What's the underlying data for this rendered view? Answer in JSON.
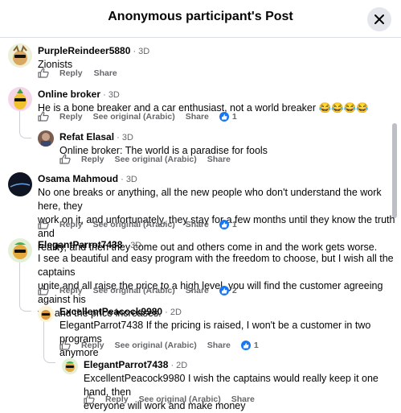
{
  "dialog": {
    "title": "Anonymous participant's Post"
  },
  "labels": {
    "reply": "Reply",
    "share": "Share",
    "see_original": "See original (Arabic)"
  },
  "comments": [
    {
      "author": "PurpleReindeer5880",
      "time": "3D",
      "text": "Zionists"
    },
    {
      "author": "Online broker",
      "time": "3D",
      "text": "He is a bone breaker and a car enthusiast, not a world breaker 😂😂😂😂",
      "reactions": "1"
    },
    {
      "author": "Refat Elasal",
      "time": "3D",
      "text": "Online broker: The world is a paradise for fools"
    },
    {
      "author": "Osama Mahmoud",
      "time": "3D",
      "text_lines": [
        "No one breaks or anything, all the new people who don't understand the work here, they",
        "work on it, and unfortunately, they stay for a few months until they know the truth and",
        "reality, and then they come out and others come in and the work gets worse."
      ],
      "reactions": "1"
    },
    {
      "author": "ElegantParrot7438",
      "time": "3D",
      "text_lines": [
        "I see a beautiful and easy program with the freedom to choose, but I wish all the captains",
        "unite and all raise the price to a high level, you will find the customer agreeing against his",
        "will and the price increases."
      ],
      "reactions": "2"
    },
    {
      "author": "ExcellentPeacock9980",
      "time": "2D",
      "text_lines": [
        "ElegantParrot7438 If the pricing is raised, I won't be a customer in two programs",
        "anymore"
      ],
      "reactions": "1"
    },
    {
      "author": "ElegantParrot7438",
      "time": "2D",
      "text_lines": [
        "ExcellentPeacock9980 I wish the captains would really keep it one hand, then",
        "everyone will work and make money"
      ]
    }
  ]
}
